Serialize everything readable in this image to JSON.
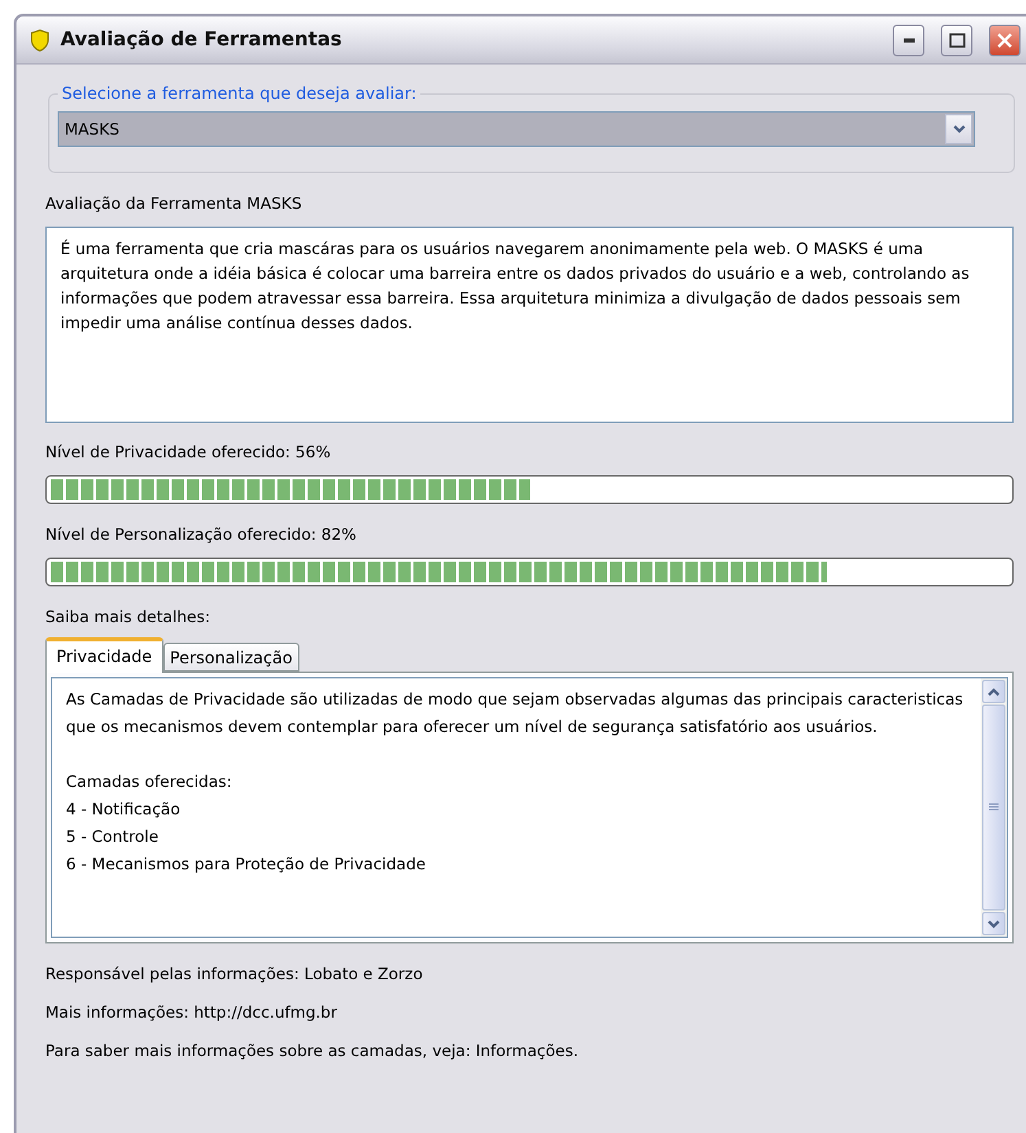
{
  "window": {
    "title": "Avaliação de Ferramentas"
  },
  "tool_select": {
    "legend": "Selecione a ferramenta que deseja avaliar:",
    "value": "MASKS"
  },
  "evaluation": {
    "heading": "Avaliação da Ferramenta  MASKS",
    "description": "É uma ferramenta que cria mascáras para os usuários navegarem anonimamente pela web. O MASKS é uma arquitetura onde a idéia básica é colocar uma barreira entre os dados privados do usuário e a web, controlando as informações que podem atravessar essa barreira. Essa arquitetura minimiza a divulgação de dados pessoais sem impedir uma análise contínua desses dados."
  },
  "meters": [
    {
      "label": "Nível de Privacidade oferecido: 56%",
      "level": 0.5
    },
    {
      "label": "Nível de Personalização oferecido: 82%",
      "level": 0.81
    }
  ],
  "details_label": "Saiba mais detalhes:",
  "tabs": [
    {
      "label": "Privacidade",
      "selected": true
    },
    {
      "label": "Personalização",
      "selected": false
    }
  ],
  "tab_panel": {
    "paragraphs": [
      "As Camadas de Privacidade são utilizadas de modo que sejam observadas algumas das principais caracteristicas que os mecanismos devem contemplar para oferecer um nível de segurança satisfatório aos usuários.",
      "Camadas oferecidas:\n4 - Notificação\n5 - Controle\n6 - Mecanismos para Proteção de Privacidade"
    ]
  },
  "footer": [
    "Responsável pelas informações: Lobato e Zorzo",
    "Mais informações: http://dcc.ufmg.br",
    "Para saber mais informações sobre as camadas, veja: Informações."
  ]
}
